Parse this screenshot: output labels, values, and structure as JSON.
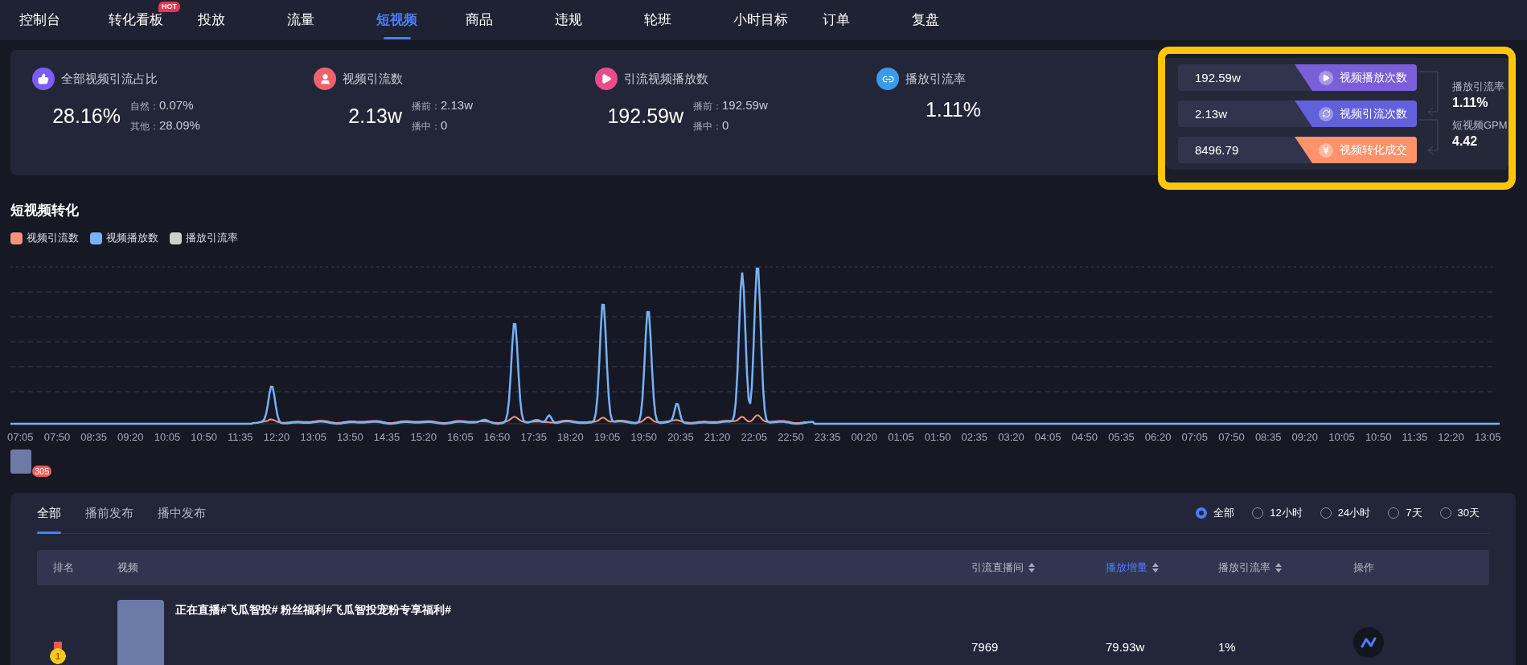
{
  "nav": [
    {
      "label": "控制台",
      "selected": false
    },
    {
      "label": "转化看板",
      "selected": false,
      "badge": "HOT"
    },
    {
      "label": "投放",
      "selected": false
    },
    {
      "label": "流量",
      "selected": false
    },
    {
      "label": "短视频",
      "selected": true
    },
    {
      "label": "商品",
      "selected": false
    },
    {
      "label": "违规",
      "selected": false
    },
    {
      "label": "轮班",
      "selected": false
    },
    {
      "label": "小时目标",
      "selected": false
    },
    {
      "label": "订单",
      "selected": false
    },
    {
      "label": "复盘",
      "selected": false
    }
  ],
  "metrics": [
    {
      "kind": "thumb",
      "label": "全部视频引流占比",
      "value": "28.16%",
      "details": [
        {
          "label": "自然：",
          "value": "0.07%"
        },
        {
          "label": "其他：",
          "value": "28.09%"
        }
      ]
    },
    {
      "kind": "person",
      "label": "视频引流数",
      "value": "2.13w",
      "details": [
        {
          "label": "播前：",
          "value": "2.13w"
        },
        {
          "label": "播中：",
          "value": "0"
        }
      ]
    },
    {
      "kind": "play",
      "label": "引流视频播放数",
      "value": "192.59w",
      "details": [
        {
          "label": "播前：",
          "value": "192.59w"
        },
        {
          "label": "播中：",
          "value": "0"
        }
      ]
    },
    {
      "kind": "link",
      "label": "播放引流率",
      "value": "1.11%"
    }
  ],
  "funnel": {
    "highlighted": true,
    "rows": [
      {
        "kind": "play",
        "value": "192.59w",
        "label": "视频播放次数",
        "color": "#7b5fd9"
      },
      {
        "kind": "link",
        "value": "2.13w",
        "label": "视频引流次数",
        "color": "#6360dc"
      },
      {
        "kind": "yen",
        "value": "8496.79",
        "label": "视频转化成交",
        "color": "#fe926c"
      }
    ],
    "ratios": [
      {
        "label": "播放引流率",
        "value": "1.11%"
      },
      {
        "label": "短视频GPM",
        "value": "4.42"
      }
    ]
  },
  "chart": {
    "title": "短视频转化",
    "legend": [
      {
        "label": "视频引流数",
        "color": "#f2937a"
      },
      {
        "label": "视频播放数",
        "color": "#76b2f7"
      },
      {
        "label": "播放引流率",
        "color": "#cfcfcf"
      }
    ],
    "x_labels": [
      "07:05",
      "07:50",
      "08:35",
      "09:20",
      "10:05",
      "10:50",
      "11:35",
      "12:20",
      "13:05",
      "13:50",
      "14:35",
      "15:20",
      "16:05",
      "16:50",
      "17:35",
      "18:20",
      "19:05",
      "19:50",
      "20:35",
      "21:20",
      "22:05",
      "22:50",
      "23:35",
      "00:20",
      "01:05",
      "01:50",
      "02:35",
      "03:20",
      "04:05",
      "04:50",
      "05:35",
      "06:20",
      "07:05",
      "07:50",
      "08:35",
      "09:20",
      "10:05",
      "10:50",
      "11:35",
      "12:20",
      "13:05"
    ],
    "marker": {
      "count": "305"
    }
  },
  "list": {
    "tabs": [
      {
        "label": "全部",
        "selected": true
      },
      {
        "label": "播前发布",
        "selected": false
      },
      {
        "label": "播中发布",
        "selected": false
      }
    ],
    "ranges": [
      {
        "label": "全部",
        "selected": true
      },
      {
        "label": "12小时",
        "selected": false
      },
      {
        "label": "24小时",
        "selected": false
      },
      {
        "label": "7天",
        "selected": false
      },
      {
        "label": "30天",
        "selected": false
      }
    ],
    "columns": [
      {
        "label": "排名",
        "sortable": false,
        "selected": false
      },
      {
        "label": "视频",
        "sortable": false,
        "selected": false
      },
      {
        "label": "引流直播间",
        "sortable": true,
        "selected": false
      },
      {
        "label": "播放增量",
        "sortable": true,
        "selected": true
      },
      {
        "label": "播放引流率",
        "sortable": true,
        "selected": false
      },
      {
        "label": "操作",
        "sortable": false,
        "selected": false
      }
    ],
    "rows": [
      {
        "rank": "1",
        "title": "正在直播#飞瓜智投# 粉丝福利#飞瓜智投宠粉专享福利#",
        "room": "7969",
        "plays": "79.93w",
        "rate": "1%"
      }
    ]
  }
}
